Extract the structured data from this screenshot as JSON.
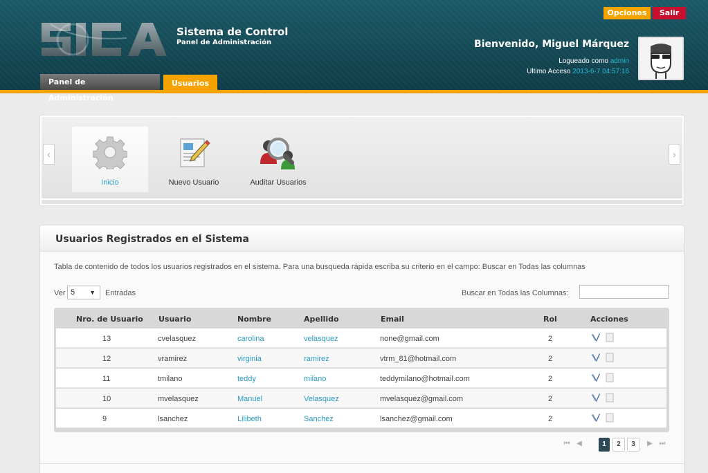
{
  "header": {
    "system_title": "Sistema de Control",
    "system_subtitle": "Panel de Administración",
    "tabs": [
      {
        "label": "Panel de Administración"
      },
      {
        "label": "Usuarios"
      }
    ],
    "opciones_label": "Opciones",
    "salir_label": "Salir",
    "welcome": "Bienvenido, Miguel Márquez",
    "logged_prefix": "Logueado como ",
    "logged_user": "admin",
    "last_access_prefix": "Ultimo Acceso ",
    "last_access_value": "2013-6-7 04:57:16"
  },
  "shortcuts": [
    {
      "label": "Inicio",
      "icon": "gear-icon",
      "active": true
    },
    {
      "label": "Nuevo Usuario",
      "icon": "edit-document-icon",
      "active": false
    },
    {
      "label": "Auditar Usuarios",
      "icon": "audit-users-icon",
      "active": false
    }
  ],
  "users_panel": {
    "title": "Usuarios Registrados en el Sistema",
    "description": "Tabla de contenido de todos los usuarios registrados en el sistema. Para una busqueda rápida escriba su criterio en el campo: Buscar en Todas las columnas",
    "ver_label": "Ver",
    "page_size": "5",
    "entradas_label": "Entradas",
    "search_label": "Buscar en Todas las Columnas:",
    "search_value": "",
    "columns": [
      "Nro. de Usuario",
      "Usuario",
      "Nombre",
      "Apellido",
      "Email",
      "Rol",
      "Acciones"
    ],
    "rows": [
      {
        "nro": "13",
        "usuario": "cvelasquez",
        "nombre": "carolina",
        "apellido": "velasquez",
        "email": "none@gmail.com",
        "rol": "2"
      },
      {
        "nro": "12",
        "usuario": "vramirez",
        "nombre": "virginia",
        "apellido": "ramirez",
        "email": "vtrm_81@hotmail.com",
        "rol": "2"
      },
      {
        "nro": "11",
        "usuario": "tmilano",
        "nombre": "teddy",
        "apellido": "milano",
        "email": "teddymilano@hotmail.com",
        "rol": "2"
      },
      {
        "nro": "10",
        "usuario": "mvelasquez",
        "nombre": "Manuel",
        "apellido": "Velasquez",
        "email": "mvelasquez@gmail.com",
        "rol": "2"
      },
      {
        "nro": "9",
        "usuario": "lsanchez",
        "nombre": "Lilibeth",
        "apellido": "Sanchez",
        "email": "lsanchez@gmail.com",
        "rol": "2"
      }
    ],
    "pages": [
      "1",
      "2",
      "3"
    ],
    "current_page": "1"
  },
  "colors": {
    "accent": "#f6a300",
    "header_bg": "#12434f",
    "link": "#2a9bc2",
    "danger": "#c8102e"
  }
}
